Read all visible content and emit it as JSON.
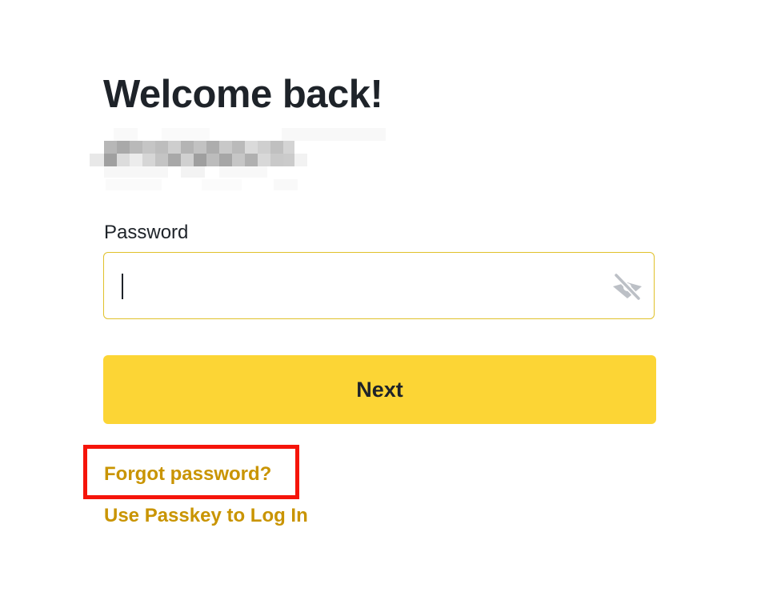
{
  "heading": {
    "title": "Welcome back!"
  },
  "account": {
    "masked": true
  },
  "password": {
    "label": "Password",
    "value": "",
    "placeholder": "",
    "visibility_icon": "eye-slash-icon"
  },
  "actions": {
    "next_label": "Next",
    "forgot_password_label": "Forgot password?",
    "passkey_label": "Use Passkey to Log In"
  },
  "colors": {
    "accent": "#fcd535",
    "link": "#c99400",
    "text": "#1e2329",
    "field_border": "#e0c12b",
    "highlight": "#f5140a"
  }
}
